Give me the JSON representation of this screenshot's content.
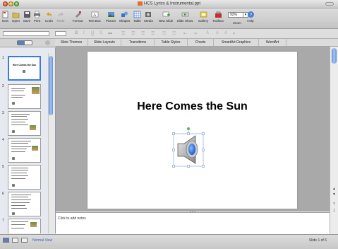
{
  "window": {
    "title": "HCS Lyrics & Instrumental.ppt"
  },
  "toolbar": {
    "buttons": [
      {
        "label": "New",
        "icon": "new-icon",
        "enabled": true
      },
      {
        "label": "Open",
        "icon": "open-icon",
        "enabled": true
      },
      {
        "label": "Save",
        "icon": "save-icon",
        "enabled": true
      },
      {
        "label": "Print",
        "icon": "print-icon",
        "enabled": true
      },
      {
        "label": "Undo",
        "icon": "undo-icon",
        "enabled": true
      },
      {
        "label": "Redo",
        "icon": "redo-icon",
        "enabled": false
      },
      {
        "label": "Format",
        "icon": "format-icon",
        "enabled": true
      },
      {
        "label": "Text Box",
        "icon": "text-box-icon",
        "enabled": true
      },
      {
        "label": "Picture",
        "icon": "picture-icon",
        "enabled": true
      },
      {
        "label": "Shapes",
        "icon": "shapes-icon",
        "enabled": true
      },
      {
        "label": "Table",
        "icon": "table-icon",
        "enabled": true
      },
      {
        "label": "Media",
        "icon": "media-icon",
        "enabled": true
      },
      {
        "label": "New Slide",
        "icon": "new-slide-icon",
        "enabled": true
      },
      {
        "label": "Slide Show",
        "icon": "slide-show-icon",
        "enabled": true
      },
      {
        "label": "Gallery",
        "icon": "gallery-icon",
        "enabled": true
      },
      {
        "label": "Toolbox",
        "icon": "toolbox-icon",
        "enabled": true
      }
    ],
    "zoom": {
      "value": "92%",
      "label": "Zoom"
    },
    "help": {
      "label": "Help",
      "icon": "help-icon"
    }
  },
  "ribbon": {
    "tabs": [
      "Slide Themes",
      "Slide Layouts",
      "Transitions",
      "Table Styles",
      "Charts",
      "SmartArt Graphics",
      "WordArt"
    ]
  },
  "sidebar": {
    "thumbnails": [
      {
        "number": "1",
        "selected": true,
        "title": "Here Comes the Sun"
      },
      {
        "number": "2",
        "selected": false
      },
      {
        "number": "3",
        "selected": false
      },
      {
        "number": "4",
        "selected": false
      },
      {
        "number": "5",
        "selected": false
      },
      {
        "number": "6",
        "selected": false
      },
      {
        "number": "7",
        "selected": false
      }
    ]
  },
  "slide": {
    "title": "Here Comes the Sun",
    "media_icon": "speaker-icon"
  },
  "notes": {
    "placeholder": "Click to add notes"
  },
  "status": {
    "view_label": "Normal View",
    "slide_count": "Slide 1 of 6"
  },
  "colors": {
    "selection_blue": "#3a7cd8",
    "accent_blue": "#5a7fc0"
  }
}
